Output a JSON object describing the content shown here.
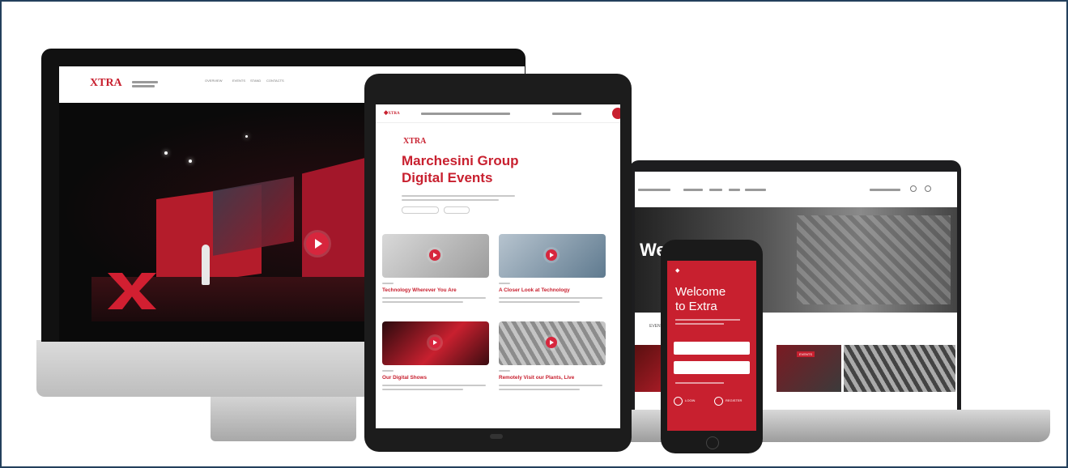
{
  "desktop": {
    "logo": "XTRA",
    "nav": [
      "OVERVIEW",
      "EVENTS",
      "STAND",
      "CONTACTS"
    ]
  },
  "tablet": {
    "logo_text": "XTRA",
    "hero_title_line1": "Marchesini Group",
    "hero_title_line2": "Digital Events",
    "cards": [
      {
        "title": "Technology Wherever You Are"
      },
      {
        "title": "A Closer Look at Technology"
      },
      {
        "title": "Our Digital Shows"
      },
      {
        "title": "Remotely Visit our Plants, Live"
      }
    ]
  },
  "laptop": {
    "hero_title": "Welco",
    "tab_label": "EVENTS",
    "banner_label": "EVENTS"
  },
  "phone": {
    "title_line1": "Welcome",
    "title_line2": "to Extra",
    "login_label": "LOGIN",
    "register_label": "REGISTER"
  },
  "colors": {
    "brand_red": "#c8202f",
    "frame_border": "#23405c",
    "device_black": "#1d1d1f"
  }
}
